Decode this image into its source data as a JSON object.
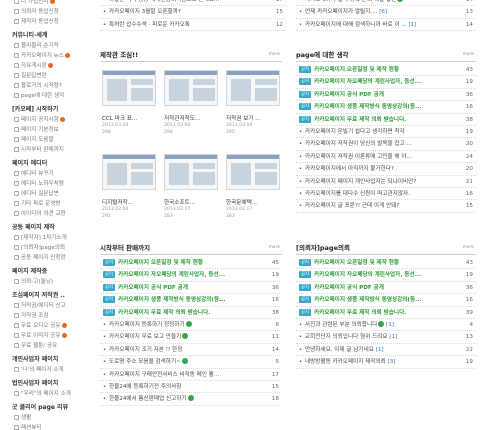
{
  "sidebar": {
    "groups": [
      {
        "title": "",
        "items": [
          {
            "label": "디 가입인사",
            "new": true
          },
          {
            "label": "의뢰자 동업신청",
            "new": false
          },
          {
            "label": "제작자 동업신청",
            "new": false
          }
        ]
      },
      {
        "title": "커뮤니티·세계",
        "items": [
          {
            "label": "블리블리 순기적",
            "new": false
          },
          {
            "label": "카카오페이지 뉴스",
            "new": true
          },
          {
            "label": "자유게시판",
            "new": true
          },
          {
            "label": "질문답변란",
            "new": false
          },
          {
            "label": "블로거의 시작점?",
            "new": false
          },
          {
            "label": "page에 대한 생각",
            "new": false
          }
        ]
      },
      {
        "title": "[카오페] 시작하기",
        "items": [
          {
            "label": "페이지 공지사항",
            "new": true
          },
          {
            "label": "페이지 기본정보",
            "new": false
          },
          {
            "label": "페이지 도움말",
            "new": false
          },
          {
            "label": "시작부터 판매까지",
            "new": false
          }
        ]
      },
      {
        "title": "페이지 에디터",
        "items": [
          {
            "label": "에디터 뷰꾸기",
            "new": false
          },
          {
            "label": "에디터 노하우처럼",
            "new": false
          },
          {
            "label": "에디터 질문답변",
            "new": false
          },
          {
            "label": "기타 파로 운영방",
            "new": false
          },
          {
            "label": "아이디어 의견 교환",
            "new": false
          }
        ]
      },
      {
        "title": "공동 페이지 제작",
        "items": [
          {
            "label": "[제작자] 1차기소개",
            "new": false
          },
          {
            "label": "[의뢰자]page의뢰",
            "new": false
          },
          {
            "label": "공동 페이지 신청란",
            "new": false
          }
        ]
      },
      {
        "title": "페이지 제작증",
        "items": [
          {
            "label": "의뢰-고(돌님)",
            "new": false
          }
        ]
      },
      {
        "title": "조심페이지 저작권 ..",
        "items": [
          {
            "label": "저작권/에디터 신고",
            "new": false
          },
          {
            "label": "저작권 조심",
            "new": false
          },
          {
            "label": "무료 오디오 공유",
            "new": true
          },
          {
            "label": "무료 이미지 공유",
            "new": true
          },
          {
            "label": "무료 웹툰/ 공유",
            "new": false
          }
        ]
      },
      {
        "title": "개인사업자 페이지",
        "items": [
          {
            "label": "'나'의 페이지 소개",
            "new": false
          }
        ]
      },
      {
        "title": "법인사업자 페이지",
        "items": [
          {
            "label": "\"우리\"의 페이지 소개",
            "new": false
          }
        ]
      },
      {
        "title": "굿 클리어 page 리뷰",
        "items": [
          {
            "label": "생활",
            "new": false
          },
          {
            "label": "패션뷰티",
            "new": false
          }
        ]
      }
    ]
  },
  "top_left_list": [
    {
      "text": "하열한 학력 상당 세계전통의약품소조 본대표...",
      "count": "17",
      "icon": false
    },
    {
      "text": "카카오페이지 3월말 오픈할까?",
      "count": "15",
      "icon": false
    },
    {
      "text": "특허란 압수수색 · 피로운 카카오톡",
      "count": "12",
      "icon": false
    }
  ],
  "top_right_list": [
    {
      "text": "카카오페이지 일력 등록 문의 해실 답변",
      "count": "14",
      "icon": true
    },
    {
      "text": "언제 카카오페이지가 열릴지.... ",
      "reply": "[6]",
      "count": "13",
      "icon": false
    },
    {
      "text": "카카오페이지에 대해 검색하니까 바로 이 ...",
      "reply": "[1]",
      "count": "14",
      "icon": false
    }
  ],
  "gallery": {
    "title": "제작관 조심!!",
    "more": "more",
    "items": [
      {
        "title": "CCL 마크 표...",
        "date": "2013.03.04",
        "count": "298"
      },
      {
        "title": "저작관저작도...",
        "date": "2013.03.04",
        "count": "298"
      },
      {
        "title": "저작권 보기 ...",
        "date": "2013.03.04",
        "count": "295"
      },
      {
        "title": "디지털저작...",
        "date": "2013.02.04",
        "count": "292"
      },
      {
        "title": "한국소프트...",
        "date": "2013.02.17",
        "count": "283"
      },
      {
        "title": "한국문예텍...",
        "date": "2013.02.17",
        "count": "283"
      }
    ]
  },
  "opinions": {
    "title": "page에 대한 생각",
    "more": "more",
    "tag_label": "공지",
    "rows": [
      {
        "notice": true,
        "text": "카카오페이지 오픈일정 및 제작 현황",
        "count": "43"
      },
      {
        "notice": true,
        "text": "카카오페이지 자오페당의 계린사업자, 등선...",
        "count": "19"
      },
      {
        "notice": true,
        "text": "카카오페이지 공식 PDF 공개",
        "count": "36"
      },
      {
        "notice": true,
        "text": "카카오페이지 생풍 제작방식 동영상강의(등...",
        "count": "16"
      },
      {
        "notice": true,
        "text": "카카오페이지 무료 제작 의뢰 받습니다.",
        "count": "38"
      },
      {
        "notice": false,
        "text": "카카오페이지 온빌기 쉽다고 생각하면 착각",
        "count": "19"
      },
      {
        "notice": false,
        "text": "카카오페이지 저작권이 당신의 발목을 잡고 ...",
        "count": "20"
      },
      {
        "notice": false,
        "text": "카카오페이지 저작권 이론류에 고민을 해 야...",
        "count": "24"
      },
      {
        "notice": false,
        "text": "카카오페이지에서 아직까지 불가한다?",
        "count": "20"
      },
      {
        "notice": false,
        "text": "카카오페이지 페이지 개인사업자는 되냐이비안?",
        "count": "21"
      },
      {
        "notice": false,
        "text": "카카오페이지를 대다수 신원이 떠고관지않자.",
        "count": "16"
      },
      {
        "notice": false,
        "text": "카카오페이지 글 포른?! 근데 이게 안돼?",
        "count": "15"
      }
    ]
  },
  "sales": {
    "title": "시작부터 판매까지",
    "more": "more",
    "tag_label": "공지",
    "rows": [
      {
        "notice": true,
        "text": "카카오페이지 오픈일정 및 제작 현황",
        "count": "45"
      },
      {
        "notice": true,
        "text": "카카오페이지 자오페당의 계린사업자, 등선...",
        "count": "19"
      },
      {
        "notice": true,
        "text": "카카오페이지 공식 PDF 공개",
        "count": "36"
      },
      {
        "notice": true,
        "text": "카카오페이지 생풍 제작방식 동영상강의(등...",
        "count": "16"
      },
      {
        "notice": true,
        "text": "카카오페이지 무료 제작 의뢰 받습니다.",
        "count": "38"
      },
      {
        "notice": false,
        "text": "카카오페이지 등록하기 정정하기",
        "count": "8",
        "icon": true
      },
      {
        "notice": false,
        "text": "카카오페이지 무료 보고 만들기",
        "count": "11",
        "icon": true
      },
      {
        "notice": false,
        "text": "카카오페이지 조기 자본 !! 한정",
        "count": "14",
        "icon": false
      },
      {
        "notice": false,
        "text": "도로명 주소 모음을 검색하기~",
        "count": "5",
        "icon": true
      },
      {
        "notice": false,
        "text": "카카오페이지 구매안전서비스 비작동 메인 활...",
        "count": "17",
        "icon": false
      },
      {
        "notice": false,
        "text": "한물24에 등록하기전 주의사항",
        "count": "15",
        "icon": false
      },
      {
        "notice": false,
        "text": "한물24에서 통신판매업 신고하기",
        "count": "18",
        "icon": true
      }
    ]
  },
  "requests": {
    "title": "[의뢰자]page의뢰",
    "more": "more",
    "tag_label": "공지",
    "rows": [
      {
        "notice": true,
        "text": "카카오페이지 오픈일정 및 제작 현황",
        "count": "43"
      },
      {
        "notice": true,
        "text": "카카오페이지 자오페당의 계린사업자, 등선...",
        "count": "19"
      },
      {
        "notice": true,
        "text": "카카오페이지 공식 PDF 공개",
        "count": "36"
      },
      {
        "notice": true,
        "text": "카카오페이지 생풍 제작방식 동영상강의(등...",
        "count": "16"
      },
      {
        "notice": true,
        "text": "카카오페이지 무료 제작 의뢰 받습니다.",
        "count": "39"
      },
      {
        "notice": false,
        "text": "사진과 관련된 부분 의뢰합니다",
        "reply": "[1]",
        "count": "4",
        "icon": true
      },
      {
        "notice": false,
        "text": "교회전단지 의뢰입니다 형위 드려요",
        "reply": "[1]",
        "count": "13",
        "icon": false
      },
      {
        "notice": false,
        "text": "안녕하세요. 이제 글 남기네요",
        "reply": "[1]",
        "count": "22",
        "icon": false
      },
      {
        "notice": false,
        "text": "내방방활동 카카오페이지 제작의뢰",
        "reply": "[3]",
        "count": "19",
        "icon": false
      }
    ]
  }
}
